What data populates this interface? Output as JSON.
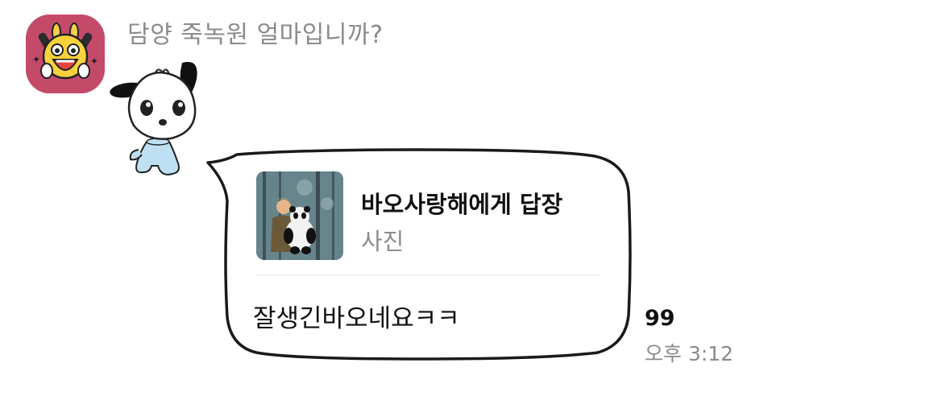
{
  "chat": {
    "sender_name": "담양 죽녹원 얼마입니까?",
    "avatar_icon": "yellow-character-avatar-icon",
    "sticker_icon": "white-puppy-sticker-icon"
  },
  "message": {
    "reply": {
      "title": "바오사랑해에게 답장",
      "subtitle": "사진",
      "thumbnail_icon": "person-holding-panda-photo"
    },
    "text": "잘생긴바오네요ㅋㅋ",
    "unread_count": "99",
    "time": "오후 3:12"
  },
  "colors": {
    "avatar_bg": "#c44a6a",
    "bubble_border": "#1a1a1a",
    "meta_text": "#8a8a8a"
  }
}
